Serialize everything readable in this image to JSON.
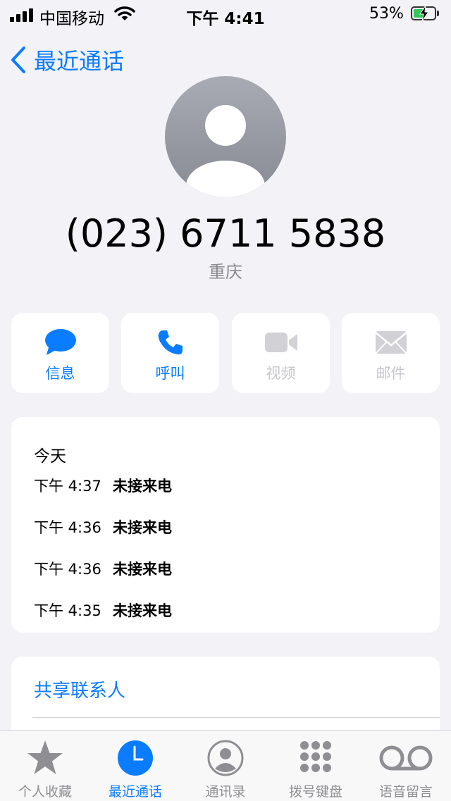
{
  "status_bar": {
    "carrier": "中国移动",
    "time": "下午 4:41",
    "battery": "53%"
  },
  "nav": {
    "back_label": "最近通话"
  },
  "contact": {
    "phone": "(023) 6711 5838",
    "location": "重庆"
  },
  "actions": [
    {
      "label": "信息",
      "icon": "message-bubble-icon",
      "enabled": true
    },
    {
      "label": "呼叫",
      "icon": "phone-icon",
      "enabled": true
    },
    {
      "label": "视频",
      "icon": "video-camera-icon",
      "enabled": false
    },
    {
      "label": "邮件",
      "icon": "envelope-icon",
      "enabled": false
    }
  ],
  "recents": {
    "day": "今天",
    "calls": [
      {
        "time": "下午 4:37",
        "type": "未接来电"
      },
      {
        "time": "下午 4:36",
        "type": "未接来电"
      },
      {
        "time": "下午 4:36",
        "type": "未接来电"
      },
      {
        "time": "下午 4:35",
        "type": "未接来电"
      }
    ]
  },
  "share": {
    "label": "共享联系人"
  },
  "tabs": [
    {
      "label": "个人收藏",
      "icon": "star-icon",
      "active": false
    },
    {
      "label": "最近通话",
      "icon": "clock-icon",
      "active": true
    },
    {
      "label": "通讯录",
      "icon": "person-circle-icon",
      "active": false
    },
    {
      "label": "拨号键盘",
      "icon": "keypad-icon",
      "active": false
    },
    {
      "label": "语音留言",
      "icon": "voicemail-icon",
      "active": false
    }
  ],
  "colors": {
    "accent": "#0a7cff",
    "background": "#f2f2f7",
    "disabled": "#c7c7cc",
    "battery": "#34c759"
  }
}
